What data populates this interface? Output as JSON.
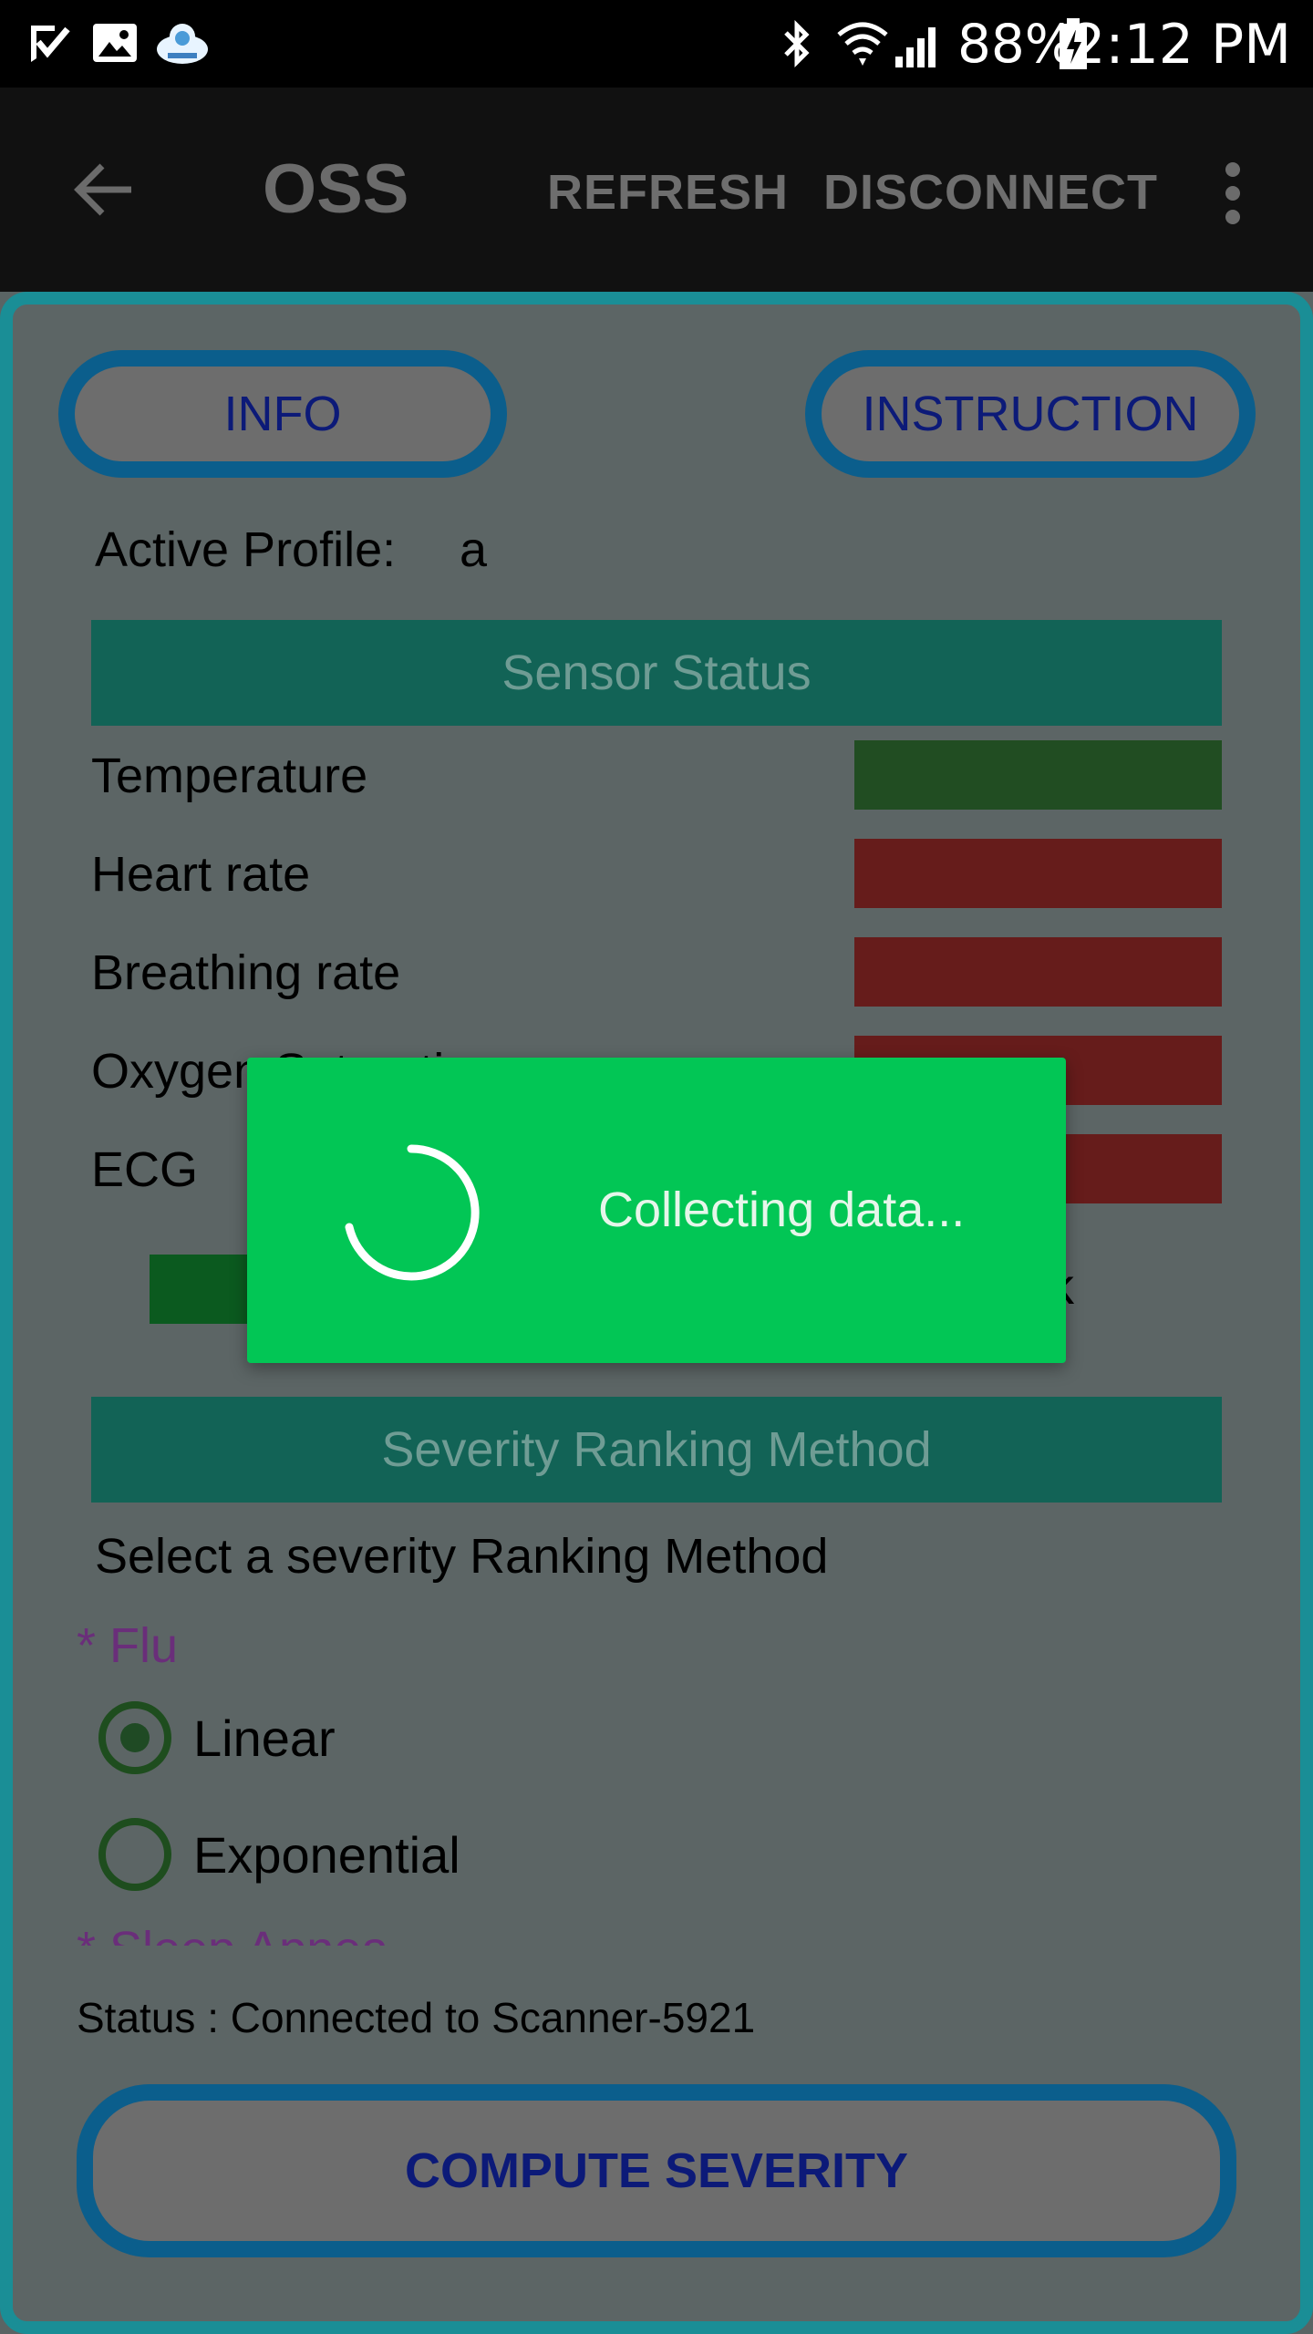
{
  "statusbar": {
    "battery_pct": "88%",
    "time": "2:12 PM"
  },
  "appbar": {
    "title": "OSS",
    "refresh": "REFRESH",
    "disconnect": "DISCONNECT"
  },
  "buttons": {
    "info": "INFO",
    "instruction": "INSTRUCTION",
    "compute": "COMPUTE SEVERITY"
  },
  "profile": {
    "label": "Active Profile:",
    "value": "a"
  },
  "sensor_status": {
    "header": "Sensor Status",
    "items": [
      {
        "label": "Temperature",
        "color": "#214d22"
      },
      {
        "label": "Heart rate",
        "color": "#661c1b"
      },
      {
        "label": "Breathing rate",
        "color": "#661c1b"
      },
      {
        "label": "Oxygen Saturation",
        "color": "#661c1b"
      },
      {
        "label": "ECG",
        "color": "#661c1b"
      }
    ]
  },
  "severity": {
    "header": "Severity Ranking Method",
    "prompt": "Select a severity Ranking Method",
    "flu_label": "* Flu",
    "linear": "Linear",
    "exponential": "Exponential",
    "sleep_label": "* Sleep Apnea"
  },
  "status": "Status : Connected to Scanner-5921",
  "dialog": {
    "message": "Collecting data..."
  },
  "colors": {
    "accent": "#1a8e96",
    "dialog_bg": "#02c655",
    "button_text": "#0c1a78"
  }
}
